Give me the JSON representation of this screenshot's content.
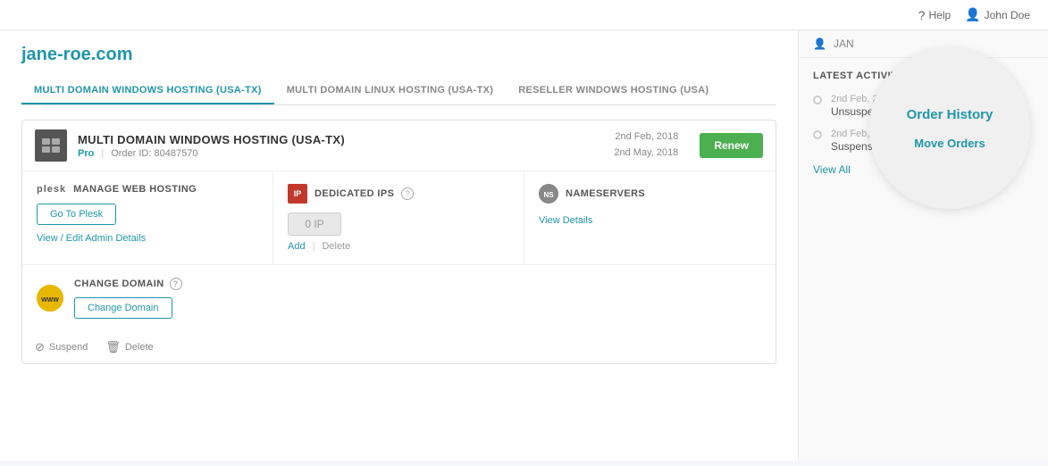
{
  "topbar": {
    "help_label": "Help",
    "user_label": "John Doe"
  },
  "domain": {
    "title": "jane-roe.com"
  },
  "tabs": [
    {
      "id": "multi-domain-windows",
      "label": "MULTI DOMAIN WINDOWS HOSTING (USA-TX)",
      "active": true
    },
    {
      "id": "multi-domain-linux",
      "label": "MULTI DOMAIN LINUX HOSTING (USA-TX)",
      "active": false
    },
    {
      "id": "reseller-windows",
      "label": "RESELLER WINDOWS HOSTING (USA)",
      "active": false
    }
  ],
  "order": {
    "name": "MULTI DOMAIN WINDOWS HOSTING (USA-TX)",
    "badge": "Pro",
    "order_id_label": "Order ID: 80487570",
    "date_start": "2nd Feb, 2018",
    "date_end": "2nd May, 2018",
    "renew_label": "Renew"
  },
  "services": {
    "manage_web_hosting": {
      "label": "MANAGE WEB HOSTING",
      "plesk_text": "plesk",
      "go_plesk_label": "Go To Plesk",
      "view_edit_label": "View / Edit Admin Details"
    },
    "dedicated_ips": {
      "label": "DEDICATED IPS",
      "ip_value": "0 IP",
      "add_label": "Add",
      "delete_label": "Delete"
    },
    "nameservers": {
      "label": "NAMESERVERS",
      "view_details_label": "View Details"
    }
  },
  "change_domain": {
    "section_label": "CHANGE DOMAIN",
    "button_label": "Change Domain"
  },
  "footer": {
    "suspend_label": "Suspend",
    "delete_label": "Delete"
  },
  "sidebar": {
    "jan_text": "JAN",
    "history_label": "Order History",
    "move_orders_label": "Move Orders",
    "latest_activity_title": "LATEST ACTIVITY",
    "activities": [
      {
        "date": "2nd Feb, 2018",
        "text": "Unsuspension of order"
      },
      {
        "date": "2nd Feb, 2018",
        "text": "Suspension of order"
      }
    ],
    "view_all_label": "View All"
  }
}
